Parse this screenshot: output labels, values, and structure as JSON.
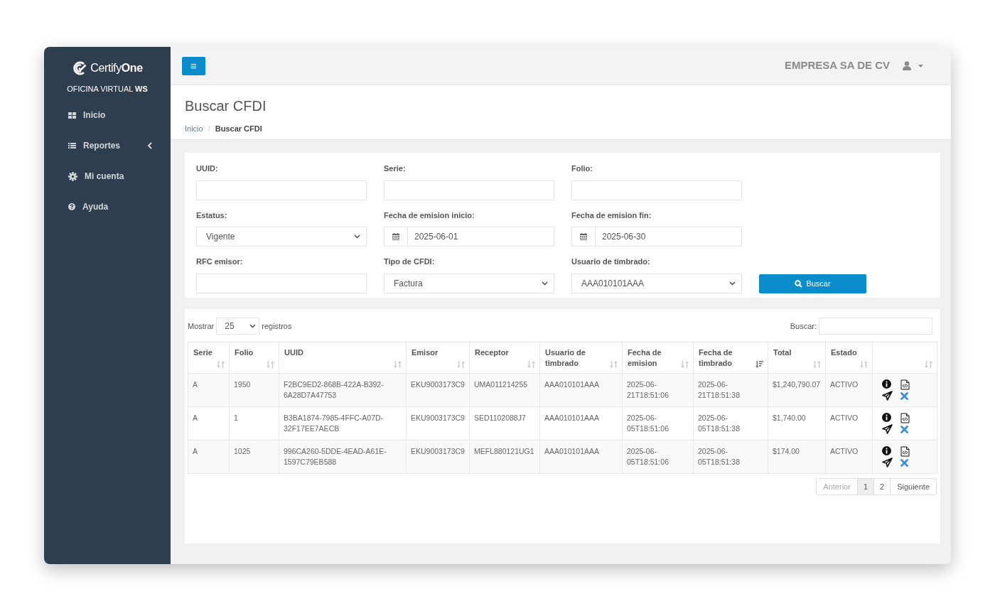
{
  "sidebar": {
    "logo": {
      "light": "Certify",
      "bold": "One"
    },
    "subtitle": {
      "text": "OFICINA VIRTUAL",
      "bold": "WS"
    },
    "items": [
      {
        "label": "Inicio",
        "expandable": false
      },
      {
        "label": "Reportes",
        "expandable": true
      },
      {
        "label": "Mi cuenta",
        "expandable": false
      },
      {
        "label": "Ayuda",
        "expandable": false
      }
    ]
  },
  "header": {
    "menu_button": "≡",
    "company": "EMPRESA SA DE CV"
  },
  "page": {
    "title": "Buscar CFDI",
    "breadcrumb_separator": "/",
    "breadcrumb": [
      {
        "label": "Inicio",
        "current": false
      },
      {
        "label": "Buscar CFDI",
        "current": true
      }
    ]
  },
  "filters": [
    {
      "label": "UUID:",
      "kind": "text"
    },
    {
      "label": "Serie:",
      "kind": "text"
    },
    {
      "label": "Folio:",
      "kind": "text"
    },
    {
      "label": "Estatus:",
      "kind": "select",
      "value": "Vigente"
    },
    {
      "label": "Fecha de emision inicio:",
      "kind": "date",
      "value": "2025-06-01"
    },
    {
      "label": "Fecha de emision fin:",
      "kind": "date",
      "value": "2025-06-30"
    },
    {
      "label": "RFC emisor:",
      "kind": "text"
    },
    {
      "label": "Tipo de CFDI:",
      "kind": "select",
      "value": "Factura"
    },
    {
      "label": "Usuario de timbrado:",
      "kind": "select",
      "value": "AAA010101AAA"
    }
  ],
  "search_button": "Buscar",
  "table": {
    "length": {
      "before": "Mostrar",
      "value": "25",
      "after": "registros"
    },
    "search_label": "Buscar:",
    "columns": [
      {
        "label": "Serie",
        "sorted_desc": false
      },
      {
        "label": "Folio",
        "sorted_desc": false
      },
      {
        "label": "UUID",
        "sorted_desc": false
      },
      {
        "label": "Emisor",
        "sorted_desc": false
      },
      {
        "label": "Receptor",
        "sorted_desc": false
      },
      {
        "label": "Usuario de timbrado",
        "sorted_desc": false
      },
      {
        "label": "Fecha de emision",
        "sorted_desc": false
      },
      {
        "label": "Fecha de timbrado",
        "sorted_desc": true
      },
      {
        "label": "Total",
        "sorted_desc": false
      },
      {
        "label": "Estado",
        "sorted_desc": false
      },
      {
        "sorted_desc": false
      }
    ],
    "rows": [
      [
        "A",
        "1950",
        "F2BC9ED2-868B-422A-B392-6A28D7A47753",
        "EKU9003173C9",
        "UMA011214255",
        "AAA010101AAA",
        "2025-06-21T18:51:06",
        "2025-06-21T18:51:38",
        "$1,240,790.07",
        "ACTIVO"
      ],
      [
        "A",
        "1",
        "B3BA1874-7985-4FFC-A07D-32F17EE7AECB",
        "EKU9003173C9",
        "SED1102088J7",
        "AAA010101AAA",
        "2025-06-05T18:51:06",
        "2025-06-05T18:51:38",
        "$1,740.00",
        "ACTIVO"
      ],
      [
        "A",
        "1025",
        "996CA260-5DDE-4EAD-A61E-1597C79EB588",
        "EKU9003173C9",
        "MEFL880121UG1",
        "AAA010101AAA",
        "2025-06-05T18:51:06",
        "2025-06-05T18:51:38",
        "$174.00",
        "ACTIVO"
      ]
    ],
    "pagination": [
      {
        "label": "Anterior",
        "kind": "prev",
        "disabled": true,
        "selected": false
      },
      {
        "label": "1",
        "kind": "page",
        "disabled": false,
        "selected": true
      },
      {
        "label": "2",
        "kind": "page",
        "disabled": false,
        "selected": false
      },
      {
        "label": "Siguiente",
        "kind": "next",
        "disabled": false,
        "selected": false
      }
    ]
  }
}
